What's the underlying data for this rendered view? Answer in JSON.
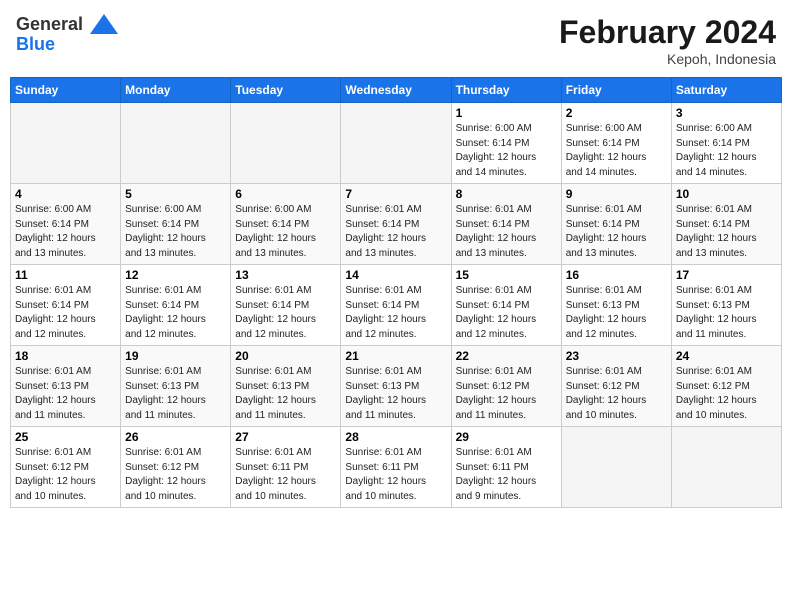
{
  "header": {
    "logo_line1": "General",
    "logo_line2": "Blue",
    "title": "February 2024",
    "subtitle": "Kepoh, Indonesia"
  },
  "weekdays": [
    "Sunday",
    "Monday",
    "Tuesday",
    "Wednesday",
    "Thursday",
    "Friday",
    "Saturday"
  ],
  "weeks": [
    [
      {
        "day": "",
        "info": ""
      },
      {
        "day": "",
        "info": ""
      },
      {
        "day": "",
        "info": ""
      },
      {
        "day": "",
        "info": ""
      },
      {
        "day": "1",
        "info": "Sunrise: 6:00 AM\nSunset: 6:14 PM\nDaylight: 12 hours\nand 14 minutes."
      },
      {
        "day": "2",
        "info": "Sunrise: 6:00 AM\nSunset: 6:14 PM\nDaylight: 12 hours\nand 14 minutes."
      },
      {
        "day": "3",
        "info": "Sunrise: 6:00 AM\nSunset: 6:14 PM\nDaylight: 12 hours\nand 14 minutes."
      }
    ],
    [
      {
        "day": "4",
        "info": "Sunrise: 6:00 AM\nSunset: 6:14 PM\nDaylight: 12 hours\nand 13 minutes."
      },
      {
        "day": "5",
        "info": "Sunrise: 6:00 AM\nSunset: 6:14 PM\nDaylight: 12 hours\nand 13 minutes."
      },
      {
        "day": "6",
        "info": "Sunrise: 6:00 AM\nSunset: 6:14 PM\nDaylight: 12 hours\nand 13 minutes."
      },
      {
        "day": "7",
        "info": "Sunrise: 6:01 AM\nSunset: 6:14 PM\nDaylight: 12 hours\nand 13 minutes."
      },
      {
        "day": "8",
        "info": "Sunrise: 6:01 AM\nSunset: 6:14 PM\nDaylight: 12 hours\nand 13 minutes."
      },
      {
        "day": "9",
        "info": "Sunrise: 6:01 AM\nSunset: 6:14 PM\nDaylight: 12 hours\nand 13 minutes."
      },
      {
        "day": "10",
        "info": "Sunrise: 6:01 AM\nSunset: 6:14 PM\nDaylight: 12 hours\nand 13 minutes."
      }
    ],
    [
      {
        "day": "11",
        "info": "Sunrise: 6:01 AM\nSunset: 6:14 PM\nDaylight: 12 hours\nand 12 minutes."
      },
      {
        "day": "12",
        "info": "Sunrise: 6:01 AM\nSunset: 6:14 PM\nDaylight: 12 hours\nand 12 minutes."
      },
      {
        "day": "13",
        "info": "Sunrise: 6:01 AM\nSunset: 6:14 PM\nDaylight: 12 hours\nand 12 minutes."
      },
      {
        "day": "14",
        "info": "Sunrise: 6:01 AM\nSunset: 6:14 PM\nDaylight: 12 hours\nand 12 minutes."
      },
      {
        "day": "15",
        "info": "Sunrise: 6:01 AM\nSunset: 6:14 PM\nDaylight: 12 hours\nand 12 minutes."
      },
      {
        "day": "16",
        "info": "Sunrise: 6:01 AM\nSunset: 6:13 PM\nDaylight: 12 hours\nand 12 minutes."
      },
      {
        "day": "17",
        "info": "Sunrise: 6:01 AM\nSunset: 6:13 PM\nDaylight: 12 hours\nand 11 minutes."
      }
    ],
    [
      {
        "day": "18",
        "info": "Sunrise: 6:01 AM\nSunset: 6:13 PM\nDaylight: 12 hours\nand 11 minutes."
      },
      {
        "day": "19",
        "info": "Sunrise: 6:01 AM\nSunset: 6:13 PM\nDaylight: 12 hours\nand 11 minutes."
      },
      {
        "day": "20",
        "info": "Sunrise: 6:01 AM\nSunset: 6:13 PM\nDaylight: 12 hours\nand 11 minutes."
      },
      {
        "day": "21",
        "info": "Sunrise: 6:01 AM\nSunset: 6:13 PM\nDaylight: 12 hours\nand 11 minutes."
      },
      {
        "day": "22",
        "info": "Sunrise: 6:01 AM\nSunset: 6:12 PM\nDaylight: 12 hours\nand 11 minutes."
      },
      {
        "day": "23",
        "info": "Sunrise: 6:01 AM\nSunset: 6:12 PM\nDaylight: 12 hours\nand 10 minutes."
      },
      {
        "day": "24",
        "info": "Sunrise: 6:01 AM\nSunset: 6:12 PM\nDaylight: 12 hours\nand 10 minutes."
      }
    ],
    [
      {
        "day": "25",
        "info": "Sunrise: 6:01 AM\nSunset: 6:12 PM\nDaylight: 12 hours\nand 10 minutes."
      },
      {
        "day": "26",
        "info": "Sunrise: 6:01 AM\nSunset: 6:12 PM\nDaylight: 12 hours\nand 10 minutes."
      },
      {
        "day": "27",
        "info": "Sunrise: 6:01 AM\nSunset: 6:11 PM\nDaylight: 12 hours\nand 10 minutes."
      },
      {
        "day": "28",
        "info": "Sunrise: 6:01 AM\nSunset: 6:11 PM\nDaylight: 12 hours\nand 10 minutes."
      },
      {
        "day": "29",
        "info": "Sunrise: 6:01 AM\nSunset: 6:11 PM\nDaylight: 12 hours\nand 9 minutes."
      },
      {
        "day": "",
        "info": ""
      },
      {
        "day": "",
        "info": ""
      }
    ]
  ]
}
